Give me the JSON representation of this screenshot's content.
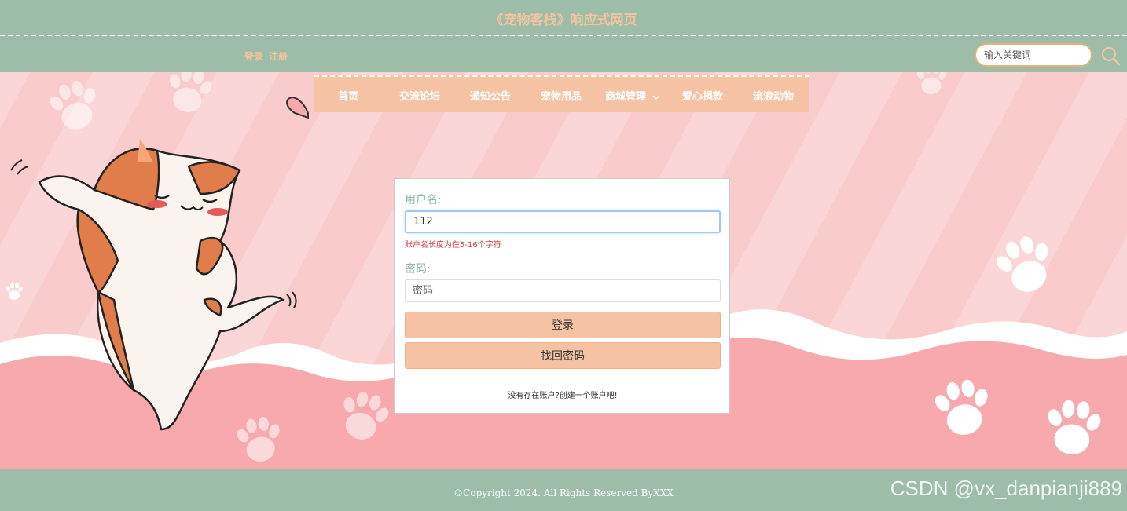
{
  "header": {
    "title": "《宠物客栈》响应式网页",
    "login_link": "登录",
    "register_link": "注册",
    "search_placeholder": "输入关键词"
  },
  "nav": {
    "items": [
      {
        "label": "首页"
      },
      {
        "label": "交流论坛"
      },
      {
        "label": "通知公告"
      },
      {
        "label": "宠物用品"
      },
      {
        "label": "商城管理",
        "has_dropdown": true
      },
      {
        "label": "爱心捐款"
      },
      {
        "label": "流浪动物"
      }
    ]
  },
  "login_form": {
    "username_label": "用户名:",
    "username_value": "112",
    "username_error": "账户名长度为在5-16个字符",
    "password_label": "密码:",
    "password_placeholder": "密码",
    "login_button": "登录",
    "reset_button": "找回密码",
    "register_hint": "没有存在账户?创建一个账户吧!"
  },
  "footer": {
    "copyright": "©Copyright 2024. All Rights Reserved ByXXX",
    "watermark": "CSDN @vx_danpianji889"
  },
  "colors": {
    "header_bg": "#9dbda8",
    "accent": "#f5c3a3",
    "title_text": "#f4c3a0",
    "hero_pink": "#f9cbcb",
    "wave_pink": "#f7a9ad",
    "error": "#d04040"
  },
  "icons": {
    "search": "search-icon",
    "dropdown": "chevron-down-icon",
    "mascot": "cat-illustration",
    "paws": "paw-print-icon"
  }
}
